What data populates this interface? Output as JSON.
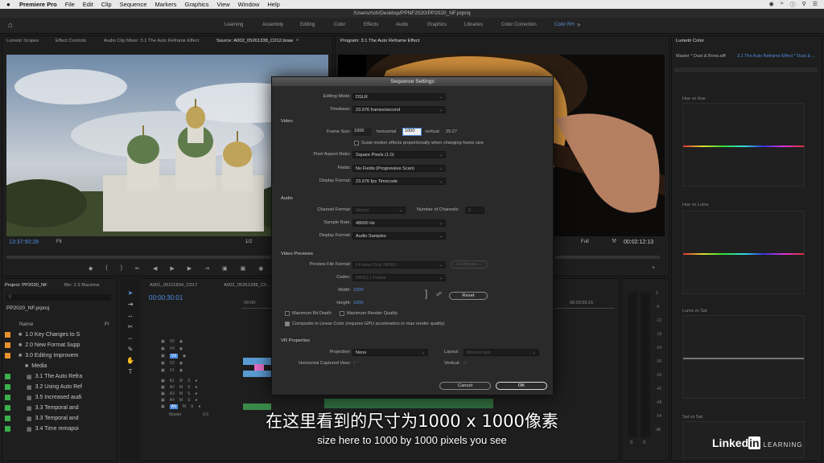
{
  "menubar": {
    "apple": "",
    "app": "Premiere Pro",
    "items": [
      "File",
      "Edit",
      "Clip",
      "Sequence",
      "Markers",
      "Graphics",
      "View",
      "Window",
      "Help"
    ]
  },
  "titlebar": {
    "path": "/Users/rich/Desktop/PPNF2020/PP2020_NF.prproj"
  },
  "workspaces": {
    "items": [
      "Learning",
      "Assembly",
      "Editing",
      "Color",
      "Effects",
      "Audio",
      "Graphics",
      "Libraries",
      "Color Correction",
      "Color RH"
    ],
    "active": "Color RH"
  },
  "panel_tabs": {
    "left": [
      "Lumetri Scopes",
      "Effect Controls",
      "Audio Clip Mixer: 3.1 The Auto Reframe Effect",
      "Source: A002_05261338_C012.braw"
    ],
    "program": "Program: 3.1 The Auto Reframe Effect",
    "lumetri": "Lumetri Color"
  },
  "source_monitor": {
    "timecode": "13:37:50:28",
    "fit": "Fit",
    "ratio": "1/2"
  },
  "program_monitor": {
    "fit": "Full",
    "timecode": "00:02:12:13"
  },
  "lumetri": {
    "master": "Master * Dust & Bone.aiff",
    "clip": "3.1 The Auto Reframe Effect * Dust & ...",
    "curves": [
      "Hue vs Hue",
      "Hue vs Luma",
      "Luma vs Sat",
      "Sat vs Sat"
    ]
  },
  "dialog": {
    "title": "Sequence Settings",
    "editing_mode_label": "Editing Mode:",
    "editing_mode": "DSLR",
    "timebase_label": "Timebase:",
    "timebase": "23.976 frames/second",
    "video_section": "Video",
    "frame_size_label": "Frame Size:",
    "frame_w": "1000",
    "horizontal_label": "horizontal",
    "frame_h": "1000",
    "vertical_label": "vertical",
    "aspect": "25:27",
    "scale_motion": "Scale motion effects proportionally when changing frame size",
    "pixel_aspect_label": "Pixel Aspect Ratio:",
    "pixel_aspect": "Square Pixels (1.0)",
    "fields_label": "Fields:",
    "fields": "No Fields (Progressive Scan)",
    "display_format_label": "Display Format:",
    "display_format": "23.976 fps Timecode",
    "audio_section": "Audio",
    "channel_format_label": "Channel Format:",
    "channel_format": "Stereo",
    "num_channels_label": "Number of Channels:",
    "num_channels": "2",
    "sample_rate_label": "Sample Rate:",
    "sample_rate": "48000 Hz",
    "audio_display_format_label": "Display Format:",
    "audio_display_format": "Audio Samples",
    "previews_section": "Video Previews",
    "preview_format_label": "Preview File Format:",
    "preview_format": "I-Frame Only MPEG",
    "configure": "Configure...",
    "codec_label": "Codec:",
    "codec": "MPEG I-Frame",
    "width_label": "Width:",
    "width": "1000",
    "height_label": "Height:",
    "height": "1000",
    "reset": "Reset",
    "max_bit_depth": "Maximum Bit Depth",
    "max_render": "Maximum Render Quality",
    "composite_linear": "Composite in Linear Color (requires GPU acceleration or max render quality)",
    "vr_section": "VR Properties",
    "projection_label": "Projection:",
    "projection": "None",
    "layout_label": "Layout:",
    "layout": "Monoscopic",
    "hcv_label": "Horizontal Captured View:",
    "hcv": "0 °",
    "vertical_vr_label": "Vertical:",
    "vertical_vr": "0 °",
    "cancel": "Cancel",
    "ok": "OK"
  },
  "project": {
    "tab": "Project: PP2020_NF",
    "bin_tab": "Bin: 2.3 Blackma",
    "name": "PP2020_NF.prproj",
    "col_name": "Name",
    "col_fr": "Fr",
    "items": [
      {
        "label": "1.0 Key Changes to S",
        "color": "#e8912e"
      },
      {
        "label": "2.0 New Format Supp",
        "color": "#e8912e"
      },
      {
        "label": "3.0 Editing Improvem",
        "color": "#e8912e"
      },
      {
        "label": "Media",
        "color": ""
      },
      {
        "label": "3.1 The Auto Refra",
        "color": "#3cb04a"
      },
      {
        "label": "3.2 Using Auto Ref",
        "color": "#3cb04a"
      },
      {
        "label": "3.5 Increased audi",
        "color": "#3cb04a"
      },
      {
        "label": "3.3 Temporal and",
        "color": "#3cb04a"
      },
      {
        "label": "3.3 Temporal and",
        "color": "#3cb04a"
      },
      {
        "label": "3.4 Time remapoi",
        "color": "#3cb04a"
      }
    ]
  },
  "timeline": {
    "tabs": [
      "A001_05211834_C017",
      "A002_05261338_C0..."
    ],
    "timecode": "00:00:30:01",
    "ruler_start": ":00:00",
    "ruler_end": "00:03:59:16",
    "video_tracks": [
      "V5",
      "V4",
      "V3",
      "V2",
      "V1"
    ],
    "audio_tracks": [
      "A1",
      "A2",
      "A3",
      "A4",
      "A5"
    ],
    "master": "Master",
    "master_val": "0.0"
  },
  "meter": {
    "scale": [
      "0",
      "-6",
      "-12",
      "-18",
      "-24",
      "-30",
      "-36",
      "-42",
      "-48",
      "-54",
      "dB"
    ],
    "s": "S"
  },
  "subtitles": {
    "cn": "在这里看到的尺寸为1000 x 1000像素",
    "en": "size here to 1000 by 1000 pixels you see"
  },
  "brand": {
    "linked": "Linked",
    "in": "in",
    "learning": "LEARNING"
  }
}
